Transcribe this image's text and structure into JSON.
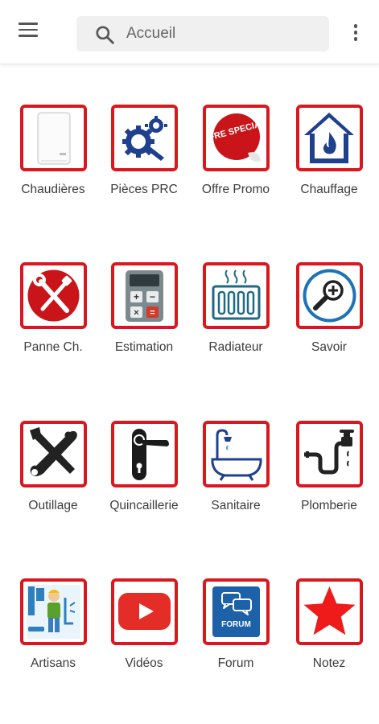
{
  "search": {
    "placeholder": "Accueil"
  },
  "tiles": [
    {
      "label": "Chaudières",
      "icon": "boiler-icon"
    },
    {
      "label": "Pièces PRC",
      "icon": "gears-icon"
    },
    {
      "label": "Offre Promo",
      "icon": "special-offer-icon",
      "badge_text": "OFFRE SPECIALE"
    },
    {
      "label": "Chauffage",
      "icon": "house-flame-icon"
    },
    {
      "label": "Panne Ch.",
      "icon": "tools-cross-icon"
    },
    {
      "label": "Estimation",
      "icon": "calculator-icon"
    },
    {
      "label": "Radiateur",
      "icon": "radiator-icon"
    },
    {
      "label": "Savoir",
      "icon": "magnifier-icon"
    },
    {
      "label": "Outillage",
      "icon": "wrench-screwdriver-icon"
    },
    {
      "label": "Quincaillerie",
      "icon": "door-handle-icon"
    },
    {
      "label": "Sanitaire",
      "icon": "bathtub-icon"
    },
    {
      "label": "Plomberie",
      "icon": "pipe-faucet-icon"
    },
    {
      "label": "Artisans",
      "icon": "plumber-icon"
    },
    {
      "label": "Vidéos",
      "icon": "youtube-icon"
    },
    {
      "label": "Forum",
      "icon": "forum-icon",
      "badge_text": "FORUM"
    },
    {
      "label": "Notez",
      "icon": "star-icon"
    }
  ],
  "colors": {
    "accent": "#d8181e",
    "icon_blue": "#1f3f8f",
    "background": "#ffffff"
  }
}
